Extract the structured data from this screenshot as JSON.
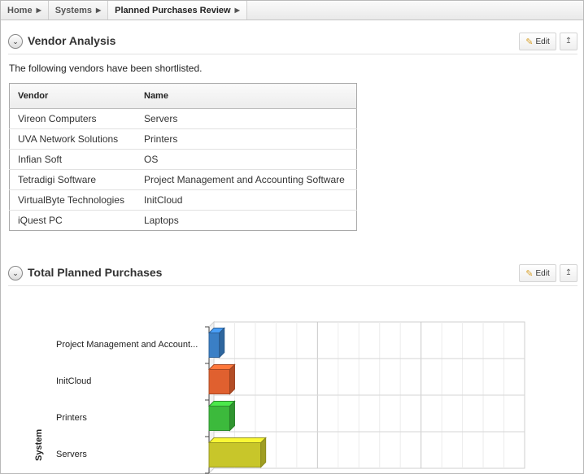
{
  "breadcrumb": [
    {
      "label": "Home"
    },
    {
      "label": "Systems"
    },
    {
      "label": "Planned Purchases Review"
    }
  ],
  "vendor_region": {
    "title": "Vendor Analysis",
    "edit_label": "Edit",
    "intro": "The following vendors have been shortlisted.",
    "columns": [
      "Vendor",
      "Name"
    ],
    "rows": [
      [
        "Vireon Computers",
        "Servers"
      ],
      [
        "UVA Network Solutions",
        "Printers"
      ],
      [
        "Infian Soft",
        "OS"
      ],
      [
        "Tetradigi Software",
        "Project Management and Accounting Software"
      ],
      [
        "VirtualByte Technologies",
        "InitCloud"
      ],
      [
        "iQuest PC",
        "Laptops"
      ]
    ]
  },
  "purchases_region": {
    "title": "Total Planned Purchases",
    "edit_label": "Edit"
  },
  "chart_data": {
    "type": "bar",
    "orientation": "horizontal",
    "ylabel": "System",
    "categories": [
      "Project Management and Account...",
      "InitCloud",
      "Printers",
      "Servers"
    ],
    "values": [
      1,
      2,
      2,
      5
    ],
    "colors": [
      "#3a7fc6",
      "#e0602f",
      "#3cba3c",
      "#c8c62a"
    ],
    "grid": true
  }
}
